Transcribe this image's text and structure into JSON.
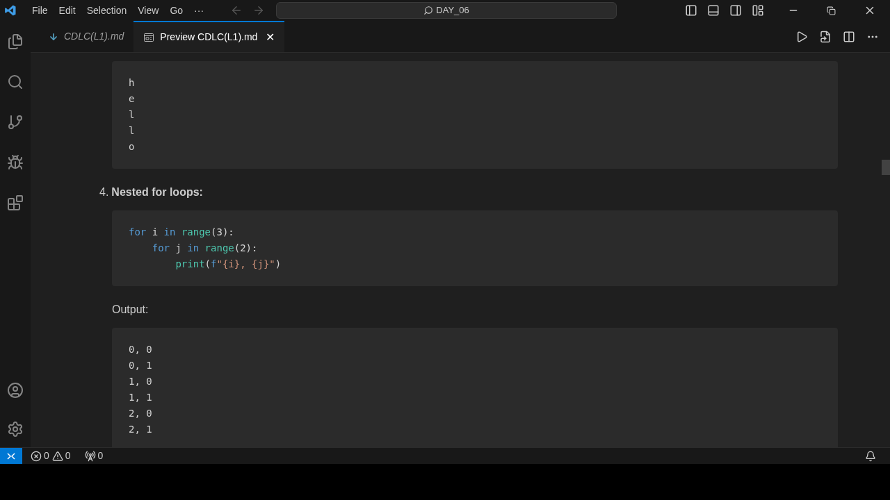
{
  "menu": [
    "File",
    "Edit",
    "Selection",
    "View",
    "Go",
    "···"
  ],
  "search": {
    "value": "DAY_06"
  },
  "tabs": [
    {
      "label": "CDLC(L1).md",
      "selected": false,
      "kind": "file"
    },
    {
      "label": "Preview CDLC(L1).md",
      "selected": true,
      "kind": "preview",
      "close": "✕"
    }
  ],
  "blocks": [
    {
      "kind": "code",
      "lines": [
        [
          {
            "text": "h",
            "kind": "plain"
          }
        ],
        [
          {
            "text": "e",
            "kind": "plain"
          }
        ],
        [
          {
            "text": "l",
            "kind": "plain"
          }
        ],
        [
          {
            "text": "l",
            "kind": "plain"
          }
        ],
        [
          {
            "text": "o",
            "kind": "plain"
          }
        ]
      ]
    },
    {
      "kind": "item",
      "number": "4.",
      "text": "Nested for loops:"
    },
    {
      "kind": "code",
      "lines": [
        [
          {
            "text": "for",
            "kind": "kw"
          },
          {
            "text": " i ",
            "kind": "plain"
          },
          {
            "text": "in",
            "kind": "kw"
          },
          {
            "text": " range",
            "kind": "func"
          },
          {
            "text": "(3):",
            "kind": "plain"
          }
        ],
        [
          {
            "text": "    for",
            "kind": "kw"
          },
          {
            "text": " j ",
            "kind": "plain"
          },
          {
            "text": "in",
            "kind": "kw"
          },
          {
            "text": " range",
            "kind": "func"
          },
          {
            "text": "(2):",
            "kind": "plain"
          }
        ],
        [
          {
            "text": "        print",
            "kind": "func"
          },
          {
            "text": "(",
            "kind": "plain"
          },
          {
            "text": "f",
            "kind": "kw"
          },
          {
            "text": "\"{i}, {j}\"",
            "kind": "string"
          },
          {
            "text": ")",
            "kind": "plain"
          }
        ]
      ]
    },
    {
      "kind": "para",
      "text": "Output:"
    },
    {
      "kind": "code",
      "lines": [
        [
          {
            "text": "0, 0",
            "kind": "plain"
          }
        ],
        [
          {
            "text": "0, 1",
            "kind": "plain"
          }
        ],
        [
          {
            "text": "1, 0",
            "kind": "plain"
          }
        ],
        [
          {
            "text": "1, 1",
            "kind": "plain"
          }
        ],
        [
          {
            "text": "2, 0",
            "kind": "plain"
          }
        ],
        [
          {
            "text": "2, 1",
            "kind": "plain"
          }
        ]
      ]
    }
  ],
  "status": {
    "errors": "0",
    "warnings": "0",
    "ports": "0"
  }
}
